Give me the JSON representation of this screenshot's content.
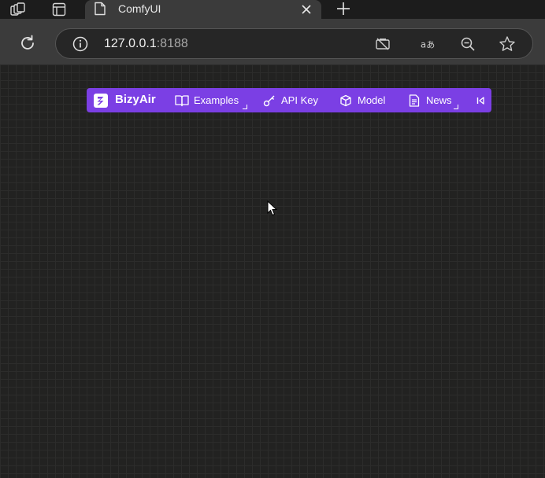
{
  "browser": {
    "tab": {
      "title": "ComfyUI"
    },
    "address": {
      "host": "127.0.0.1",
      "port": ":8188"
    },
    "icons": {
      "workspaces": "workspaces-icon",
      "tab_actions": "tab-actions-icon",
      "page": "page-icon",
      "close": "close-icon",
      "new_tab": "plus-icon",
      "reload": "reload-icon",
      "info": "info-icon",
      "tracking": "camera-off-icon",
      "translate": "translate-icon",
      "zoom": "zoom-out-icon",
      "favorite": "star-icon"
    },
    "colors": {
      "tab_bg": "#3b3b3b",
      "strip_bg": "#1c1c1c",
      "toolbar_bg": "#3b3b3b"
    }
  },
  "bizyair": {
    "brand": "BizyAir",
    "items": [
      {
        "label": "Examples",
        "icon": "book-icon"
      },
      {
        "label": "API Key",
        "icon": "key-icon"
      },
      {
        "label": "Model",
        "icon": "cube-icon"
      },
      {
        "label": "News",
        "icon": "document-icon"
      }
    ],
    "collapse_icon": "collapse-left-icon",
    "accent": "#7b3fe4"
  }
}
